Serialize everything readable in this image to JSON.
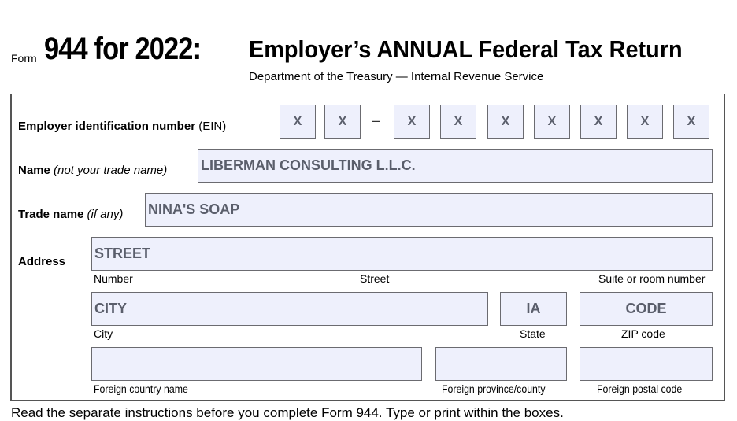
{
  "header": {
    "form_word": "Form",
    "form_number": "944 for 2022:",
    "title": "Employer’s ANNUAL Federal Tax Return",
    "subtitle": "Department of the Treasury — Internal Revenue Service"
  },
  "ein": {
    "label_bold": "Employer identification number",
    "label_plain": " (EIN)",
    "separator": "–",
    "digits": [
      "X",
      "X",
      "X",
      "X",
      "X",
      "X",
      "X",
      "X",
      "X"
    ]
  },
  "name": {
    "label_bold": "Name",
    "label_italic": " (not your trade name)",
    "value": "LIBERMAN CONSULTING L.L.C."
  },
  "trade_name": {
    "label_bold": "Trade name",
    "label_italic": " (if any)",
    "value": "NINA'S SOAP"
  },
  "address": {
    "label": "Address",
    "street_value": "STREET",
    "street_sublabels": [
      "Number",
      "Street",
      "Suite or room number"
    ],
    "city_value": "CITY",
    "city_label": "City",
    "state_value": "IA",
    "state_label": "State",
    "zip_value": "CODE",
    "zip_label": "ZIP code",
    "foreign_country_value": "",
    "foreign_country_label": "Foreign country name",
    "foreign_province_value": "",
    "foreign_province_label": "Foreign province/county",
    "foreign_postal_value": "",
    "foreign_postal_label": "Foreign postal code"
  },
  "footer_text": "Read the separate instructions before you complete Form 944. Type or print within the boxes."
}
